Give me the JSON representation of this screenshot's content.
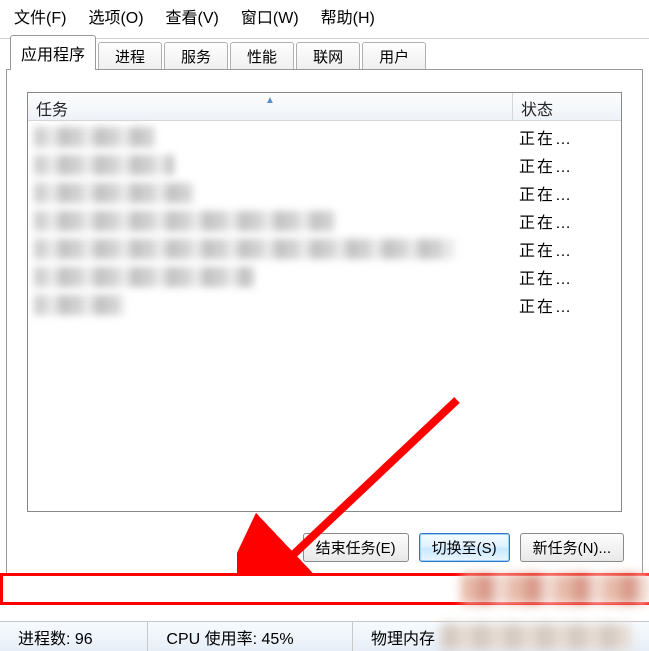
{
  "menu": {
    "file": "文件(F)",
    "options": "选项(O)",
    "view": "查看(V)",
    "window": "窗口(W)",
    "help": "帮助(H)"
  },
  "tabs": {
    "applications": "应用程序",
    "processes": "进程",
    "services": "服务",
    "performance": "性能",
    "networking": "联网",
    "users": "用户"
  },
  "columns": {
    "task": "任务",
    "status": "状态"
  },
  "rows": [
    {
      "status": "正在…"
    },
    {
      "status": "正在…"
    },
    {
      "status": "正在…"
    },
    {
      "status": "正在…"
    },
    {
      "status": "正在…"
    },
    {
      "status": "正在…"
    },
    {
      "status": "正在…"
    }
  ],
  "buttons": {
    "end_task": "结束任务(E)",
    "switch_to": "切换至(S)",
    "new_task": "新任务(N)..."
  },
  "statusbar": {
    "processes_label": "进程数: 96",
    "cpu_label": "CPU 使用率: 45%",
    "mem_label": "物理内存"
  },
  "annotation": {
    "arrow_color": "#ff0000"
  }
}
